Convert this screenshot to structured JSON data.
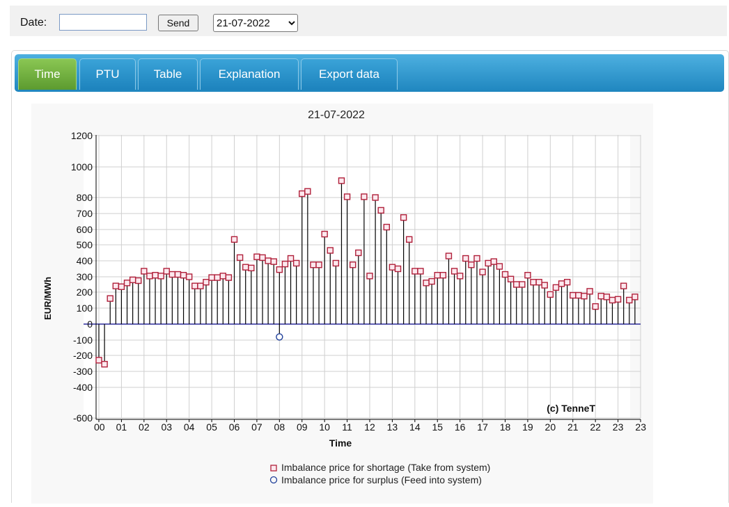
{
  "toolbar": {
    "date_label": "Date:",
    "date_value": "",
    "send_label": "Send",
    "select_value": "21-07-2022"
  },
  "tabs": [
    {
      "label": "Time",
      "active": true
    },
    {
      "label": "PTU",
      "active": false
    },
    {
      "label": "Table",
      "active": false
    },
    {
      "label": "Explanation",
      "active": false
    },
    {
      "label": "Export data",
      "active": false
    }
  ],
  "colors": {
    "shortage_marker": "#b0203a",
    "surplus_marker": "#1f3f9a",
    "stem": "#000000",
    "zero_line": "#2a2a9a",
    "active_tab": "#6aab3a",
    "tabbar": "#2b95cc"
  },
  "chart_data": {
    "type": "scatter",
    "title": "21-07-2022",
    "xlabel": "Time",
    "ylabel": "EUR/MWh",
    "watermark": "(c) TenneT",
    "grid": true,
    "xlim": [
      0,
      24
    ],
    "ylim": [
      -600,
      1200
    ],
    "y_scale": "piecewise",
    "y_ticks": [
      -600,
      -400,
      -300,
      -200,
      -100,
      0,
      100,
      200,
      300,
      400,
      500,
      600,
      700,
      800,
      1000,
      1200
    ],
    "x_tick_labels": [
      "00",
      "01",
      "02",
      "03",
      "04",
      "05",
      "06",
      "07",
      "08",
      "09",
      "10",
      "11",
      "12",
      "13",
      "14",
      "15",
      "16",
      "17",
      "18",
      "19",
      "20",
      "21",
      "22",
      "23",
      "23"
    ],
    "legend": [
      "Imbalance price for shortage (Take from system)",
      "Imbalance price for surplus (Feed into system)"
    ],
    "legend_position": "bottom-center",
    "series": [
      {
        "name": "Imbalance price for shortage (Take from system)",
        "marker": "square",
        "x": [
          0,
          0.25,
          0.5,
          0.75,
          1,
          1.25,
          1.5,
          1.75,
          2,
          2.25,
          2.5,
          2.75,
          3,
          3.25,
          3.5,
          3.75,
          4,
          4.25,
          4.5,
          4.75,
          5,
          5.25,
          5.5,
          5.75,
          6,
          6.25,
          6.5,
          6.75,
          7,
          7.25,
          7.5,
          7.75,
          8,
          8.25,
          8.5,
          8.75,
          9,
          9.25,
          9.5,
          9.75,
          10,
          10.25,
          10.5,
          10.75,
          11,
          11.25,
          11.5,
          11.75,
          12,
          12.25,
          12.5,
          12.75,
          13,
          13.25,
          13.5,
          13.75,
          14,
          14.25,
          14.5,
          14.75,
          15,
          15.25,
          15.5,
          15.75,
          16,
          16.25,
          16.5,
          16.75,
          17,
          17.25,
          17.5,
          17.75,
          18,
          18.25,
          18.5,
          18.75,
          19,
          19.25,
          19.5,
          19.75,
          20,
          20.25,
          20.5,
          20.75,
          21,
          21.25,
          21.5,
          21.75,
          22,
          22.25,
          22.5,
          22.75,
          23,
          23.25,
          23.5,
          23.75
        ],
        "values": [
          -230,
          -255,
          160,
          240,
          235,
          260,
          280,
          275,
          335,
          305,
          310,
          305,
          335,
          315,
          315,
          310,
          300,
          240,
          240,
          265,
          295,
          295,
          305,
          295,
          535,
          420,
          360,
          355,
          425,
          420,
          400,
          395,
          345,
          380,
          415,
          385,
          825,
          840,
          375,
          375,
          570,
          465,
          385,
          910,
          805,
          375,
          450,
          805,
          305,
          800,
          720,
          615,
          360,
          350,
          675,
          535,
          335,
          335,
          260,
          270,
          310,
          310,
          430,
          335,
          305,
          415,
          375,
          415,
          330,
          385,
          395,
          365,
          315,
          285,
          250,
          250,
          310,
          265,
          265,
          245,
          185,
          230,
          255,
          265,
          180,
          180,
          175,
          205,
          110,
          175,
          170,
          150,
          155,
          240,
          150,
          170
        ]
      },
      {
        "name": "Imbalance price for surplus (Feed into system)",
        "marker": "circle",
        "x": [
          8
        ],
        "values": [
          -80
        ]
      }
    ]
  }
}
